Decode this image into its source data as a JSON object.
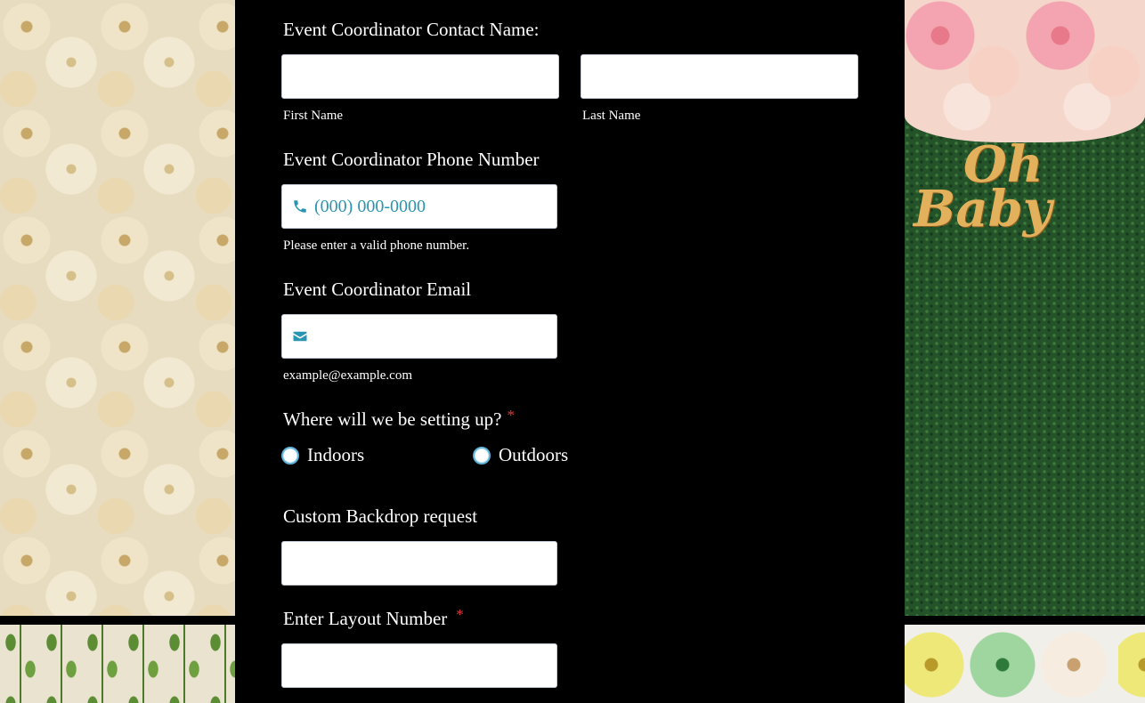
{
  "contact_name": {
    "label": "Event Coordinator Contact Name:",
    "first": {
      "value": "",
      "sublabel": "First Name"
    },
    "last": {
      "value": "",
      "sublabel": "Last Name"
    }
  },
  "phone": {
    "label": "Event Coordinator Phone Number",
    "placeholder": "(000) 000-0000",
    "value": "",
    "hint": "Please enter a valid phone number.",
    "icon": "phone-icon"
  },
  "email": {
    "label": "Event Coordinator Email",
    "value": "",
    "hint": "example@example.com",
    "icon": "envelope-icon"
  },
  "setup_location": {
    "label": "Where will we be setting up?",
    "required_mark": "*",
    "options": [
      "Indoors",
      "Outdoors"
    ]
  },
  "backdrop": {
    "label": "Custom Backdrop request",
    "value": ""
  },
  "layout_number": {
    "label": "Enter Layout Number",
    "required_mark": "*",
    "value": ""
  },
  "decor": {
    "sign_line1": "Oh",
    "sign_line2": "Baby"
  },
  "colors": {
    "background": "#000000",
    "icon_accent": "#2a95b3",
    "required": "#e53935",
    "radio_border": "#5fb3d9"
  }
}
